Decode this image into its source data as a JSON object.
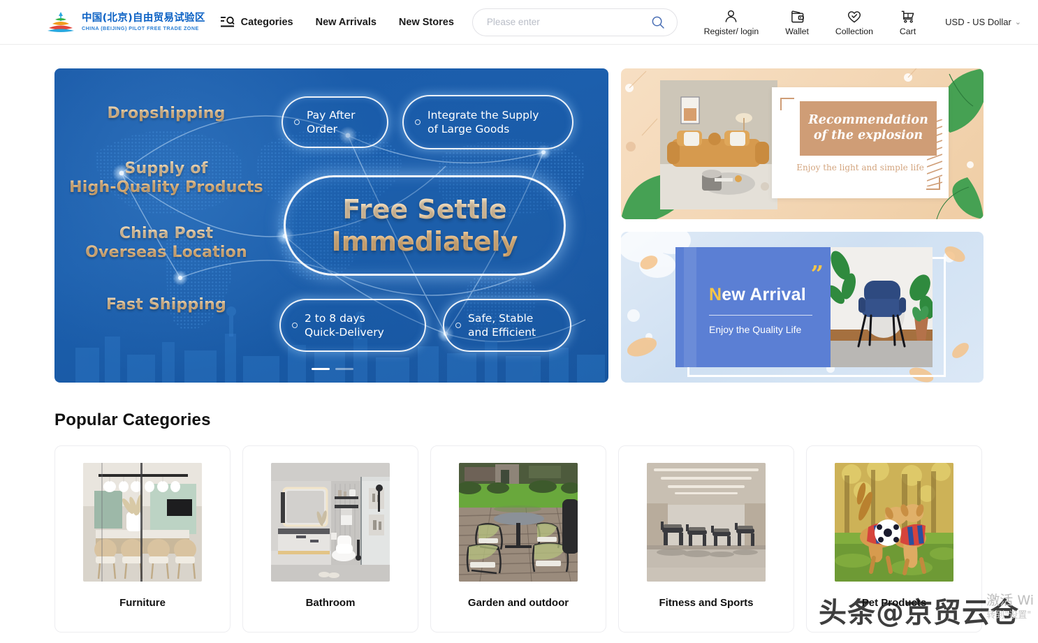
{
  "header": {
    "logo": {
      "cn": "中国(北京)自由贸易试验区",
      "en": "CHINA (BEIJING) PILOT FREE TRADE ZONE"
    },
    "nav": [
      {
        "label": "Categories",
        "icon": "categories-menu-icon"
      },
      {
        "label": "New Arrivals",
        "icon": ""
      },
      {
        "label": "New Stores",
        "icon": ""
      }
    ],
    "search": {
      "placeholder": "Please enter",
      "value": "",
      "icon": "search-icon"
    },
    "actions": [
      {
        "label": "Register/ login",
        "icon": "user-icon"
      },
      {
        "label": "Wallet",
        "icon": "wallet-icon"
      },
      {
        "label": "Collection",
        "icon": "heart-icon"
      },
      {
        "label": "Cart",
        "icon": "cart-icon"
      }
    ],
    "currency": {
      "label": "USD - US Dollar",
      "caret": "⌄"
    }
  },
  "banner": {
    "left_labels": [
      "Dropshipping",
      "Supply of\nHigh-Quality Products",
      "China Post\nOverseas Location",
      "Fast Shipping"
    ],
    "left_label_1": "Dropshipping",
    "left_label_2_line1": "Supply of",
    "left_label_2_line2": "High-Quality Products",
    "left_label_3_line1": "China Post",
    "left_label_3_line2": "Overseas Location",
    "left_label_4": "Fast Shipping",
    "pill_top_left_l1": "Pay After",
    "pill_top_left_l2": "Order",
    "pill_top_right_l1": "Integrate the Supply",
    "pill_top_right_l2": "of Large Goods",
    "pill_center_l1": "Free Settle",
    "pill_center_l2": "Immediately",
    "pill_bottom_left_l1": "2 to 8 days",
    "pill_bottom_left_l2": "Quick-Delivery",
    "pill_bottom_right_l1": "Safe, Stable",
    "pill_bottom_right_l2": "and Efficient",
    "carousel": {
      "total": 2,
      "active": 1
    }
  },
  "promos": [
    {
      "id": "recommendation",
      "title_line1": "Recommendation",
      "title_line2": "of the explosion",
      "subtitle": "Enjoy the light and simple life",
      "bg_color": "#f3d6b4",
      "accent_color": "#cf9d76"
    },
    {
      "id": "new-arrival",
      "title_first_letter": "N",
      "title_rest": "ew Arrival",
      "subtitle": "Enjoy the Quality Life",
      "quote": "”",
      "bg_color": "#cfe0f2",
      "accent_color": "#5b7fd4",
      "highlight_color": "#f6c648"
    }
  ],
  "popular": {
    "title": "Popular Categories",
    "cards": [
      {
        "label": "Furniture",
        "image": "dining-room-photo"
      },
      {
        "label": "Bathroom",
        "image": "bathroom-photo"
      },
      {
        "label": "Garden and outdoor",
        "image": "patio-furniture-photo"
      },
      {
        "label": "Fitness and Sports",
        "image": "gym-interior-photo"
      },
      {
        "label": "Pet Products",
        "image": "dogs-playing-photo"
      }
    ]
  },
  "watermarks": {
    "site": "头条@京贸云仓",
    "windows_line1": "激活 Wi",
    "windows_line2": "转到\"设置\""
  }
}
